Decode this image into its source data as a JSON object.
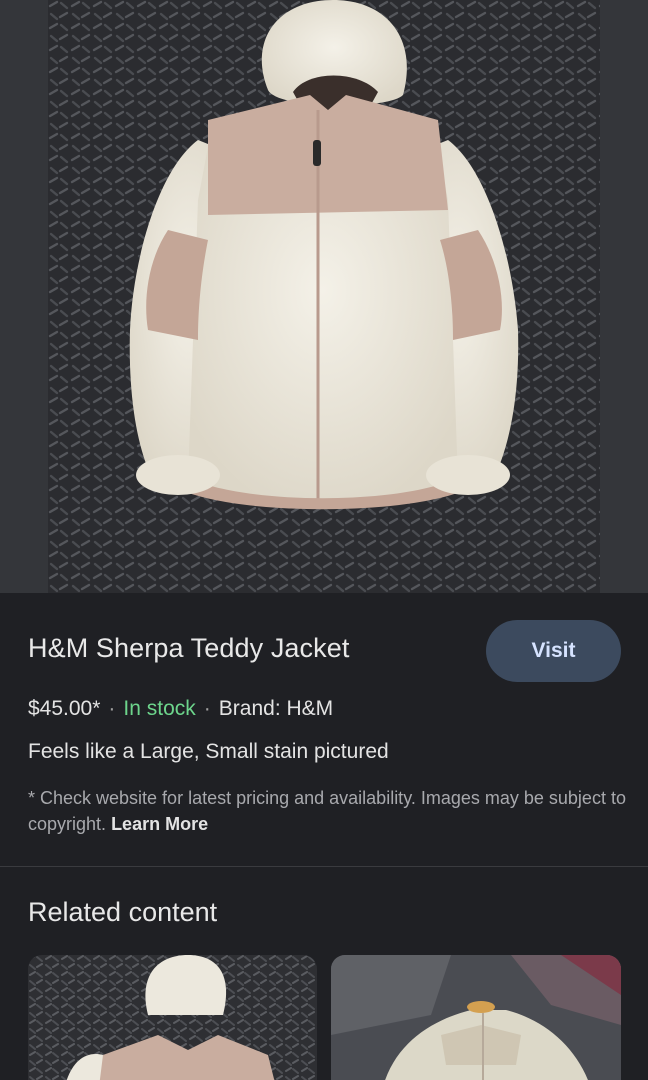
{
  "product": {
    "title": "H&M Sherpa Teddy Jacket",
    "visit_label": "Visit",
    "price": "$45.00*",
    "separator": "·",
    "stock": "In stock",
    "brand": "Brand: H&M",
    "description": "Feels like a Large, Small stain pictured",
    "disclaimer": "* Check website for latest pricing and availability. Images may be subject to copyright.",
    "learn_more": "Learn More"
  },
  "related": {
    "title": "Related content"
  },
  "colors": {
    "background": "#1f2024",
    "visit_button": "#3c4a5e",
    "stock_green": "#6dd58c",
    "jacket_cream": "#efebe0",
    "jacket_tan": "#c9ad9f"
  }
}
